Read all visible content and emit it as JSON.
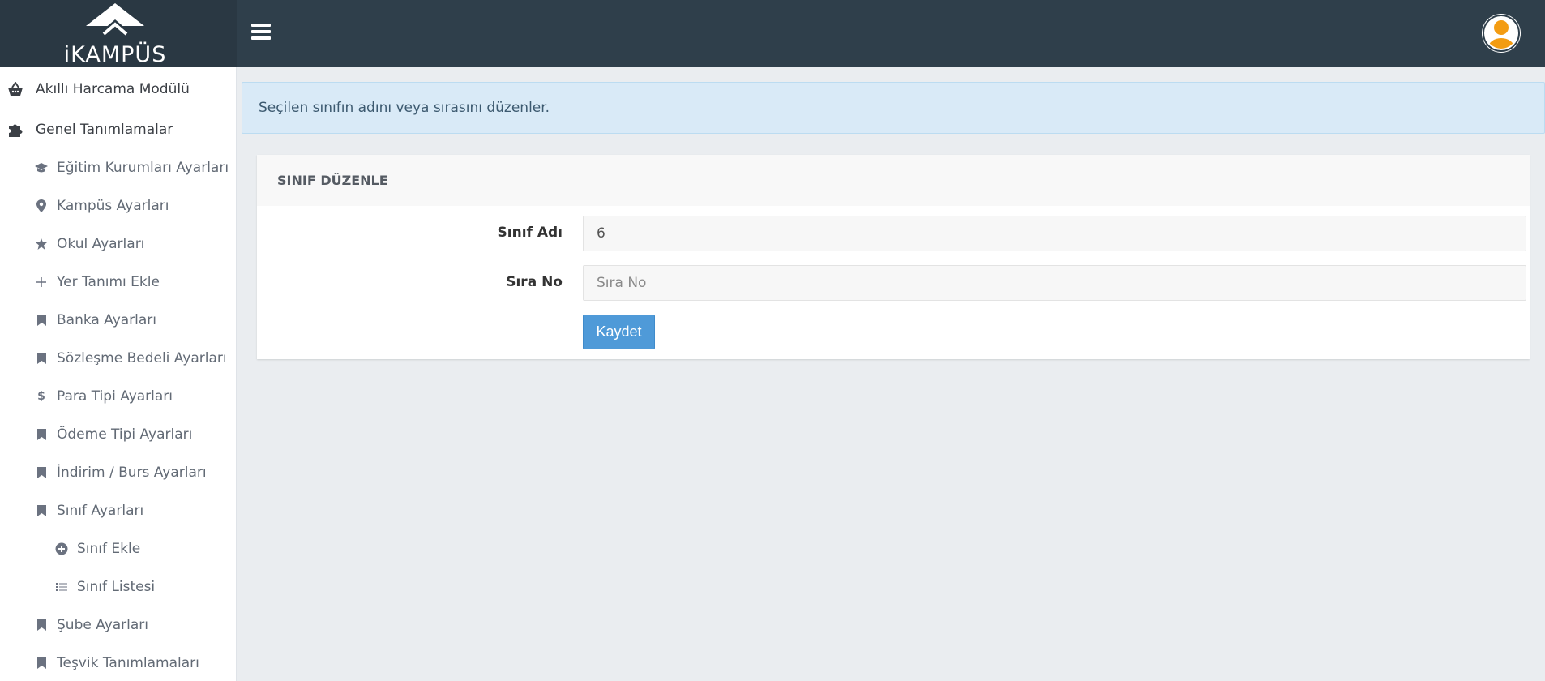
{
  "brand": {
    "name": "iKAMPÜS"
  },
  "header": {
    "menu_icon": "hamburger-icon",
    "avatar_icon": "user-avatar-icon"
  },
  "sidebar": {
    "items": [
      {
        "label": "Akıllı Harcama Modülü",
        "icon": "basket-icon",
        "level": 1
      },
      {
        "label": "Genel Tanımlamalar",
        "icon": "puzzle-icon",
        "level": 1
      },
      {
        "label": "Eğitim Kurumları Ayarları",
        "icon": "graduation-cap-icon",
        "level": 2
      },
      {
        "label": "Kampüs Ayarları",
        "icon": "map-marker-icon",
        "level": 2
      },
      {
        "label": "Okul Ayarları",
        "icon": "star-icon",
        "level": 2
      },
      {
        "label": "Yer Tanımı Ekle",
        "icon": "plus-icon",
        "level": 2
      },
      {
        "label": "Banka Ayarları",
        "icon": "bookmark-icon",
        "level": 2
      },
      {
        "label": "Sözleşme Bedeli Ayarları",
        "icon": "bookmark-icon",
        "level": 2
      },
      {
        "label": "Para Tipi Ayarları",
        "icon": "dollar-icon",
        "level": 2
      },
      {
        "label": "Ödeme Tipi Ayarları",
        "icon": "bookmark-icon",
        "level": 2
      },
      {
        "label": "İndirim / Burs Ayarları",
        "icon": "bookmark-icon",
        "level": 2
      },
      {
        "label": "Sınıf Ayarları",
        "icon": "bookmark-icon",
        "level": 2
      },
      {
        "label": "Sınıf Ekle",
        "icon": "plus-circle-icon",
        "level": 3
      },
      {
        "label": "Sınıf Listesi",
        "icon": "list-icon",
        "level": 3
      },
      {
        "label": "Şube Ayarları",
        "icon": "bookmark-icon",
        "level": 2
      },
      {
        "label": "Teşvik Tanımlamaları",
        "icon": "bookmark-icon",
        "level": 2
      }
    ]
  },
  "alert": {
    "text": "Seçilen sınıfın adını veya sırasını düzenler."
  },
  "panel": {
    "title": "SINIF DÜZENLE",
    "fields": {
      "class_name": {
        "label": "Sınıf Adı",
        "value": "6",
        "placeholder": ""
      },
      "order_no": {
        "label": "Sıra No",
        "value": "",
        "placeholder": "Sıra No"
      }
    },
    "save_label": "Kaydet"
  },
  "colors": {
    "topbar": "#2f3f4b",
    "accent_button": "#4f9ad8",
    "alert_bg": "#d9eaf7",
    "avatar_orange": "#f39c12"
  }
}
